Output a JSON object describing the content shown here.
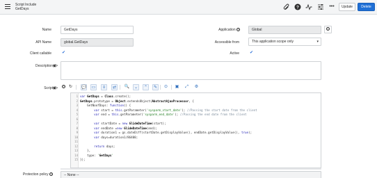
{
  "header": {
    "title": "Script Include",
    "subtitle": "GetDays",
    "icons": [
      "paperclip-icon",
      "help-icon",
      "activity-icon",
      "sliders-icon",
      "more-icon"
    ],
    "update_label": "Update",
    "delete_label": "Delete"
  },
  "form": {
    "name_label": "Name",
    "name_value": "GetDays",
    "api_label": "API Name",
    "api_value": "global.GetDays",
    "client_label": "Client callable",
    "client_checked": true,
    "application_label": "Application",
    "application_value": "Global",
    "accessible_label": "Accessible from",
    "accessible_value": "This application scope only",
    "active_label": "Active",
    "active_checked": true,
    "description_label": "Description",
    "description_value": "",
    "script_label": "Script",
    "protection_label": "Protection policy",
    "protection_value": "-- None --"
  },
  "editor": {
    "lines": [
      {
        "n": "1",
        "code": "var GetDays = Class.create();"
      },
      {
        "n": "2",
        "code": "GetDays.prototype = Object.extendsObject(AbstractAjaxProcessor, {"
      },
      {
        "n": "3",
        "code": "    GetNoofDays: function() {"
      },
      {
        "n": "4",
        "code": "        var start = this.getParameter('sysparm_start_date'); //Passing the start date from the client"
      },
      {
        "n": "5",
        "code": "        var end = this.getParameter('sysparm_end_date'); //Passing the end date from the client"
      },
      {
        "n": "6",
        "code": ""
      },
      {
        "n": "7",
        "code": "        var startDate = new GlideDateTime(start);"
      },
      {
        "n": "8",
        "code": "        var endDate =new GlideDateTime(end);"
      },
      {
        "n": "9",
        "code": "        var duration1 = gs.dateDiff(startDate.getDisplayValue(), endDate.getDisplayValue(), true);"
      },
      {
        "n": "10",
        "code": "        var days=duration1/86400;"
      },
      {
        "n": "11",
        "code": ""
      },
      {
        "n": "12",
        "code": "        return days;"
      },
      {
        "n": "13",
        "code": "    },"
      },
      {
        "n": "14",
        "code": "    type: 'GetDays'"
      },
      {
        "n": "15",
        "code": "});"
      }
    ]
  },
  "colors": {
    "accent": "#1f6fd6",
    "header_bg": "#f4f5f6",
    "checkbox": "#2a6fd8"
  }
}
